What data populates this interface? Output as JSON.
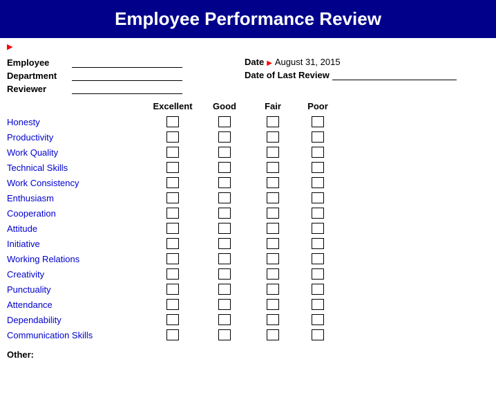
{
  "header": {
    "title": "Employee Performance Review"
  },
  "fields": {
    "employee_label": "Employee",
    "department_label": "Department",
    "reviewer_label": "Reviewer",
    "date_label": "Date",
    "date_value": "August 31, 2015",
    "last_review_label": "Date of Last Review"
  },
  "ratings": {
    "col_headers": [
      "Excellent",
      "Good",
      "Fair",
      "Poor"
    ],
    "rows": [
      "Honesty",
      "Productivity",
      "Work Quality",
      "Technical Skills",
      "Work Consistency",
      "Enthusiasm",
      "Cooperation",
      "Attitude",
      "Initiative",
      "Working Relations",
      "Creativity",
      "Punctuality",
      "Attendance",
      "Dependability",
      "Communication Skills"
    ]
  },
  "other_label": "Other:"
}
